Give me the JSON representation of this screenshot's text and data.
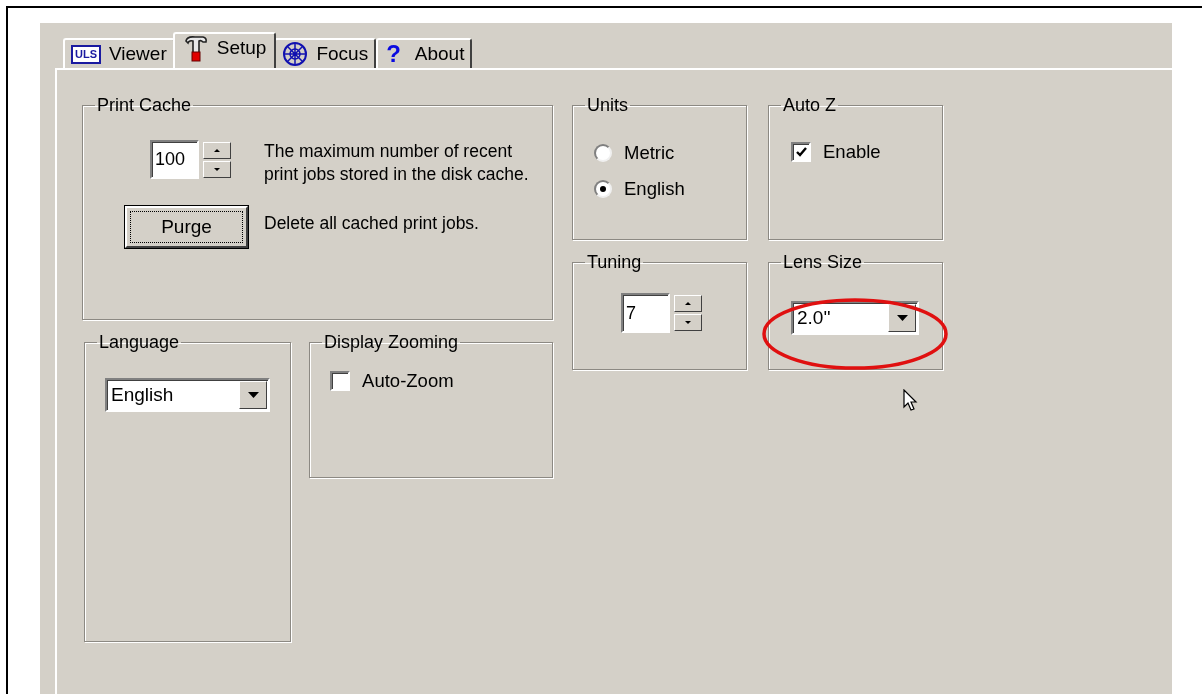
{
  "tabs": [
    {
      "label": "Viewer",
      "kind": "logo",
      "badge": "ULS",
      "selected": false
    },
    {
      "label": "Setup",
      "kind": "hammer",
      "selected": true
    },
    {
      "label": "Focus",
      "kind": "wheel",
      "selected": false
    },
    {
      "label": "About",
      "kind": "glyph",
      "glyph": "?",
      "selected": false
    }
  ],
  "print_cache": {
    "title": "Print Cache",
    "spinner": {
      "value": "100"
    },
    "spinner_note": "The maximum number of recent print jobs stored in the disk cache.",
    "button": {
      "label": "Purge",
      "focused": true
    },
    "button_note": "Delete all cached print jobs."
  },
  "language": {
    "title": "Language",
    "dropdown": {
      "value": "English"
    }
  },
  "display_zooming": {
    "title": "Display Zooming",
    "checkbox": {
      "label": "Auto-Zoom",
      "checked": false
    }
  },
  "units": {
    "title": "Units",
    "options": [
      {
        "label": "Metric",
        "selected": false
      },
      {
        "label": "English",
        "selected": true
      }
    ]
  },
  "auto_z": {
    "title": "Auto Z",
    "checkbox": {
      "label": "Enable",
      "checked": true
    }
  },
  "tuning": {
    "title": "Tuning",
    "spinner": {
      "value": "7"
    }
  },
  "lens_size": {
    "title": "Lens Size",
    "dropdown": {
      "value": "2.0''"
    },
    "highlighted": true
  }
}
